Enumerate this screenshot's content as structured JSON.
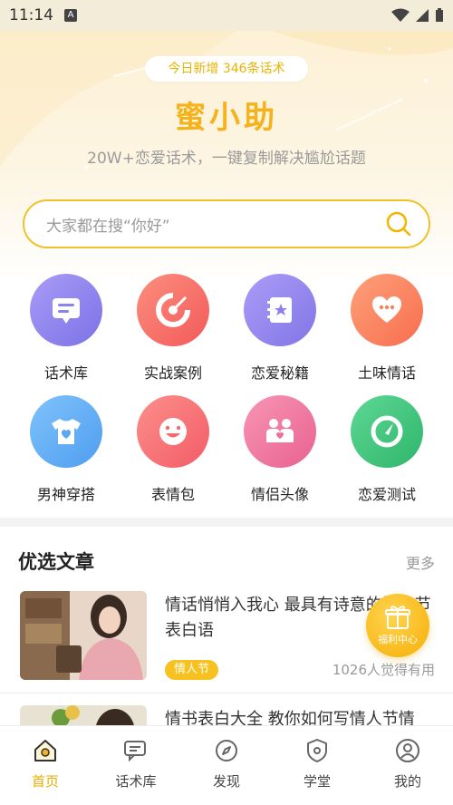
{
  "status_bar": {
    "time": "11:14",
    "notif_glyph": "A"
  },
  "hero": {
    "pill": "今日新增 346条话术",
    "brand": "蜜小助",
    "tagline": "20W+恋爱话术，一键复制解决尴尬话题"
  },
  "search": {
    "placeholder": "大家都在搜“你好”"
  },
  "grid": [
    {
      "label": "话术库",
      "icon": "message-icon",
      "color": "#8c84ee"
    },
    {
      "label": "实战案例",
      "icon": "target-icon",
      "color": "#f56c6c"
    },
    {
      "label": "恋爱秘籍",
      "icon": "book-star-icon",
      "color": "#9b8bee"
    },
    {
      "label": "土味情话",
      "icon": "heart-chat-icon",
      "color": "#fb8a63"
    },
    {
      "label": "男神穿搭",
      "icon": "tshirt-icon",
      "color": "#66b0f5"
    },
    {
      "label": "表情包",
      "icon": "smile-icon",
      "color": "#f7767a"
    },
    {
      "label": "情侣头像",
      "icon": "couple-icon",
      "color": "#f07aa0"
    },
    {
      "label": "恋爱测试",
      "icon": "gauge-icon",
      "color": "#3ec77f"
    }
  ],
  "articles_section": {
    "title": "优选文章",
    "more": "更多"
  },
  "articles": [
    {
      "title": "情话悄悄入我心 最具有诗意的情人节表白语",
      "tag": "情人节",
      "likes": "1026人觉得有用"
    },
    {
      "title": "情书表白大全 教你如何写情人节情"
    }
  ],
  "float_badge": {
    "label": "福利中心"
  },
  "tabs": [
    {
      "label": "首页",
      "icon": "home-icon",
      "active": true
    },
    {
      "label": "话术库",
      "icon": "chat-icon",
      "active": false
    },
    {
      "label": "发现",
      "icon": "compass-icon",
      "active": false
    },
    {
      "label": "学堂",
      "icon": "shield-icon",
      "active": false
    },
    {
      "label": "我的",
      "icon": "user-icon",
      "active": false
    }
  ],
  "colors": {
    "accent": "#f5b21a",
    "search_border": "#f2c02a",
    "tag": "#f7c21f"
  }
}
